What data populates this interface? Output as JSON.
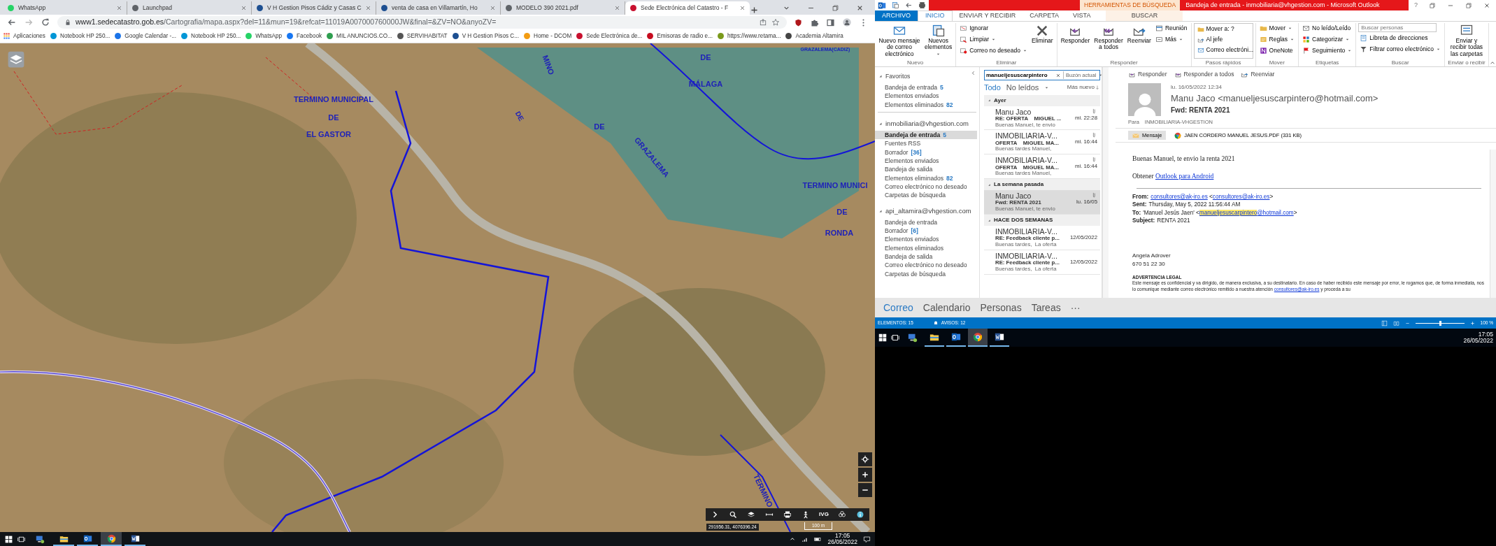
{
  "browser": {
    "tabs": [
      {
        "title": "WhatsApp",
        "selected": false,
        "color": "#25d366"
      },
      {
        "title": "Launchpad",
        "selected": false,
        "color": "#5f6368"
      },
      {
        "title": "V H Gestion Pisos Cádiz y Casas C",
        "selected": false,
        "color": "#1d4f91"
      },
      {
        "title": "venta de casa en Villamartín, Ho",
        "selected": false,
        "color": "#1d4f91"
      },
      {
        "title": "MODELO 390 2021.pdf",
        "selected": false,
        "color": "#5f6368"
      },
      {
        "title": "Sede Electrónica del Catastro - F",
        "selected": true,
        "color": "#c8102e"
      }
    ],
    "address": {
      "host": "www1.sedecatastro.gob.es",
      "path": "/Cartografia/mapa.aspx?del=11&mun=19&refcat=11019A007000760000JW&final=&ZV=NO&anyoZV="
    },
    "bookmarks": [
      {
        "label": "Aplicaciones",
        "kind": "apps"
      },
      {
        "label": "Notebook HP 250...",
        "kind": "site",
        "color": "#0096d6"
      },
      {
        "label": "Google Calendar -...",
        "kind": "site",
        "color": "#1a73e8"
      },
      {
        "label": "Notebook HP 250...",
        "kind": "site",
        "color": "#0096d6"
      },
      {
        "label": "WhatsApp",
        "kind": "site",
        "color": "#25d366"
      },
      {
        "label": "Facebook",
        "kind": "site",
        "color": "#1877f2"
      },
      {
        "label": "MIL ANUNCIOS.CO...",
        "kind": "site",
        "color": "#2e9e4f"
      },
      {
        "label": "SERVIHABITAT",
        "kind": "site",
        "color": "#555555"
      },
      {
        "label": "V H Gestion Pisos C...",
        "kind": "site",
        "color": "#1d4f91"
      },
      {
        "label": "Home - DCOM",
        "kind": "site",
        "color": "#f39c12"
      },
      {
        "label": "Sede Electrónica de...",
        "kind": "site",
        "color": "#c8102e"
      },
      {
        "label": "Emisoras de radio e...",
        "kind": "site",
        "color": "#c60b1e"
      },
      {
        "label": "https://www.retama...",
        "kind": "site",
        "color": "#7a9a1a"
      },
      {
        "label": "Academia Altamira",
        "kind": "site",
        "color": "#444444"
      }
    ]
  },
  "map": {
    "labels": [
      "GRAZALEMA(CADIZ)",
      "TERMINO MUNICIPAL",
      "DE",
      "EL GASTOR",
      "MINO",
      "DE",
      "MÁLAGA",
      "DE",
      "DE",
      "GRAZALEMA",
      "TERMINO MUNICI",
      "DE",
      "RONDA",
      "TERMINO"
    ],
    "tools": [
      {
        "kind": "expand"
      },
      {
        "kind": "search"
      },
      {
        "kind": "layers"
      },
      {
        "kind": "measure"
      },
      {
        "kind": "print"
      },
      {
        "kind": "person"
      },
      {
        "kind": "text",
        "label": "IVG"
      },
      {
        "kind": "globe"
      },
      {
        "kind": "info"
      }
    ],
    "side_controls": [
      {
        "kind": "locate"
      },
      {
        "kind": "zoom_in"
      },
      {
        "kind": "zoom_out"
      }
    ],
    "coordinates": "291956.31, 4076396.24",
    "scale": "100 m"
  },
  "taskbar_left": {
    "apps": [
      {
        "kind": "remote",
        "running": false,
        "active": false
      },
      {
        "kind": "explorer",
        "running": true,
        "active": false
      },
      {
        "kind": "outlook",
        "running": true,
        "active": false
      },
      {
        "kind": "chrome",
        "running": true,
        "active": true
      },
      {
        "kind": "word",
        "running": true,
        "active": false
      }
    ],
    "time": "17:05",
    "date": "26/05/2022"
  },
  "outlook": {
    "title_bar": {
      "context_tab": "HERRAMIENTAS DE BÚSQUEDA",
      "title": "Bandeja de entrada - inmobiliaria@vhgestion.com - Microsoft Outlook",
      "help": "?"
    },
    "ribbon_tabs": [
      {
        "label": "ARCHIVO",
        "kind": "file",
        "selected": false
      },
      {
        "label": "INICIO",
        "kind": "tab",
        "selected": true
      },
      {
        "label": "ENVIAR Y RECIBIR",
        "kind": "tab",
        "selected": false
      },
      {
        "label": "CARPETA",
        "kind": "tab",
        "selected": false
      },
      {
        "label": "VISTA",
        "kind": "tab",
        "selected": false
      },
      {
        "label": "BUSCAR",
        "kind": "context",
        "selected": false
      }
    ],
    "ribbon_groups": [
      {
        "label": "Nuevo",
        "items": [
          {
            "kind": "large",
            "label": "Nuevo mensaje de correo electrónico",
            "dropdown": false
          },
          {
            "kind": "large",
            "label": "Nuevos elementos",
            "dropdown": true
          }
        ]
      },
      {
        "label": "Eliminar",
        "items": [
          {
            "kind": "small",
            "label": "Ignorar",
            "dropdown": false
          },
          {
            "kind": "small",
            "label": "Limpiar",
            "dropdown": true
          },
          {
            "kind": "small",
            "label": "Correo no deseado",
            "dropdown": true
          },
          {
            "kind": "large",
            "label": "Eliminar",
            "dropdown": false
          }
        ]
      },
      {
        "label": "Responder",
        "items": [
          {
            "kind": "large",
            "label": "Responder",
            "dropdown": false
          },
          {
            "kind": "large",
            "label": "Responder a todos",
            "dropdown": false
          },
          {
            "kind": "large",
            "label": "Reenviar",
            "dropdown": false
          },
          {
            "kind": "small",
            "label": "Reunión",
            "dropdown": false
          },
          {
            "kind": "small",
            "label": "Más",
            "dropdown": true
          }
        ]
      },
      {
        "label": "Pasos rápidos",
        "items": [
          {
            "kind": "gallery",
            "label": "Mover a: ?"
          },
          {
            "kind": "gallery",
            "label": "Al jefe"
          },
          {
            "kind": "gallery",
            "label": "Correo electróni..."
          }
        ]
      },
      {
        "label": "Mover",
        "items": [
          {
            "kind": "small",
            "label": "Mover",
            "dropdown": true
          },
          {
            "kind": "small",
            "label": "Reglas",
            "dropdown": true
          },
          {
            "kind": "small",
            "label": "OneNote",
            "dropdown": false
          }
        ]
      },
      {
        "label": "Etiquetas",
        "items": [
          {
            "kind": "small",
            "label": "No leído/Leído",
            "dropdown": false
          },
          {
            "kind": "small",
            "label": "Categorizar",
            "dropdown": true
          },
          {
            "kind": "small",
            "label": "Seguimiento",
            "dropdown": true
          }
        ]
      },
      {
        "label": "Buscar",
        "items": [
          {
            "kind": "field",
            "placeholder": "Buscar personas"
          },
          {
            "kind": "small",
            "label": "Libreta de direcciones",
            "dropdown": false
          },
          {
            "kind": "small",
            "label": "Filtrar correo electrónico",
            "dropdown": true
          }
        ]
      },
      {
        "label": "Enviar o recibir",
        "items": [
          {
            "kind": "large",
            "label": "Enviar y recibir todas las carpetas",
            "dropdown": false
          }
        ]
      }
    ],
    "folder_sections": [
      {
        "title": "Favoritos",
        "expanded": true,
        "folders": [
          {
            "name": "Bandeja de entrada",
            "count": "5",
            "selected": false
          },
          {
            "name": "Elementos enviados",
            "selected": false
          },
          {
            "name": "Elementos eliminados",
            "count": "82",
            "selected": false
          }
        ]
      },
      {
        "title": "inmobiliaria@vhgestion.com",
        "expanded": true,
        "folders": [
          {
            "name": "Bandeja de entrada",
            "count": "5",
            "selected": true
          },
          {
            "name": "Fuentes RSS",
            "selected": false
          },
          {
            "name": "Borrador",
            "count": "[36]",
            "selected": false
          },
          {
            "name": "Elementos enviados",
            "selected": false
          },
          {
            "name": "Bandeja de salida",
            "selected": false
          },
          {
            "name": "Elementos eliminados",
            "count": "82",
            "selected": false
          },
          {
            "name": "Correo electrónico no deseado",
            "selected": false
          },
          {
            "name": "Carpetas de búsqueda",
            "selected": false
          }
        ]
      },
      {
        "title": "api_altamira@vhgestion.com",
        "expanded": true,
        "folders": [
          {
            "name": "Bandeja de entrada",
            "selected": false
          },
          {
            "name": "Borrador",
            "count": "[6]",
            "selected": false
          },
          {
            "name": "Elementos enviados",
            "selected": false
          },
          {
            "name": "Elementos eliminados",
            "selected": false
          },
          {
            "name": "Bandeja de salida",
            "selected": false
          },
          {
            "name": "Correo electrónico no deseado",
            "selected": false
          },
          {
            "name": "Carpetas de búsqueda",
            "selected": false
          }
        ]
      }
    ],
    "search": {
      "value": "manueljesuscarpintero",
      "scope": "Buzón actual"
    },
    "filters": [
      {
        "label": "Todo",
        "selected": true
      },
      {
        "label": "No leídos",
        "selected": false
      }
    ],
    "sort": "Más nuevo",
    "message_groups": [
      {
        "header": "Ayer",
        "expanded": true,
        "messages": [
          {
            "sender": "Manu Jaco",
            "subject": "RE: OFERTA    MIGUEL ...",
            "preview": "Buenas Manuel, te envio",
            "date": "mi. 22:28",
            "attachment": true,
            "selected": false
          },
          {
            "sender": "INMOBILIARIA-V...",
            "subject": "OFERTA    MIGUEL MA...",
            "preview": "Buenas tardes Manuel,",
            "date": "mi. 16:44",
            "attachment": true,
            "selected": false
          },
          {
            "sender": "INMOBILIARIA-V...",
            "subject": "OFERTA    MIGUEL MA...",
            "preview": "Buenas tardes Manuel,",
            "date": "mi. 16:44",
            "attachment": true,
            "selected": false
          }
        ]
      },
      {
        "header": "La semana pasada",
        "expanded": true,
        "messages": [
          {
            "sender": "Manu Jaco",
            "subject": "Fwd: RENTA 2021",
            "preview": "Buenas Manuel, te envio",
            "date": "lu. 16/05",
            "attachment": true,
            "selected": true
          }
        ]
      },
      {
        "header": "HACE DOS SEMANAS",
        "expanded": true,
        "messages": [
          {
            "sender": "INMOBILIARIA-V...",
            "subject": "RE: Feedback cliente p...",
            "preview": "Buenas tardes,  La oferta",
            "date": "12/05/2022",
            "attachment": false,
            "selected": false
          },
          {
            "sender": "INMOBILIARIA-V...",
            "subject": "RE: Feedback cliente p...",
            "preview": "Buenas tardes,  La oferta",
            "date": "12/05/2022",
            "attachment": false,
            "selected": false
          }
        ]
      }
    ],
    "reading": {
      "actions": [
        {
          "label": "Responder"
        },
        {
          "label": "Responder a todos"
        },
        {
          "label": "Reenviar"
        }
      ],
      "date": "lu. 16/05/2022 12:34",
      "from": "Manu Jaco <manueljesuscarpintero@hotmail.com>",
      "subject": "Fwd: RENTA 2021",
      "to_label": "Para",
      "to": "INMOBILIARIA-VHGESTION",
      "attachments": [
        {
          "label": "Mensaje",
          "kind": "message",
          "selected": true
        },
        {
          "label": "JAEN CORDERO MANUEL JESUS.PDF (331 KB)",
          "kind": "pdf",
          "selected": false
        }
      ],
      "body": [
        {
          "kind": "serif",
          "segments": [
            {
              "text": "Buenas Manuel, te envio la renta 2021"
            }
          ]
        },
        {
          "kind": "serif",
          "segments": [
            {
              "text": "Obtener "
            },
            {
              "text": "Outlook para Android",
              "link": true
            }
          ]
        },
        {
          "kind": "rule"
        },
        {
          "kind": "header",
          "label": "From:",
          "segments": [
            {
              "text": "consultores@ak-iro.es",
              "link": true
            },
            {
              "text": " <"
            },
            {
              "text": "consultores@ak-iro.es",
              "link": true
            },
            {
              "text": ">"
            }
          ]
        },
        {
          "kind": "header",
          "label": "Sent:",
          "segments": [
            {
              "text": "Thursday, May 5, 2022 11:56:44 AM"
            }
          ]
        },
        {
          "kind": "header",
          "label": "To:",
          "segments": [
            {
              "text": "'Manuel Jesús Jaen' <"
            },
            {
              "text": "manueljesuscarpintero",
              "link": true,
              "highlight": true
            },
            {
              "text": "@hotmail.com",
              "link": true
            },
            {
              "text": ">"
            }
          ]
        },
        {
          "kind": "header",
          "label": "Subject:",
          "segments": [
            {
              "text": "RENTA 2021"
            }
          ]
        },
        {
          "kind": "signature",
          "segments": [
            {
              "text": "Angela Adrover"
            }
          ]
        },
        {
          "kind": "plain",
          "segments": [
            {
              "text": "670 51 22 30"
            }
          ]
        },
        {
          "kind": "legal_title",
          "segments": [
            {
              "text": "ADVERTENCIA LEGAL"
            }
          ]
        },
        {
          "kind": "small",
          "segments": [
            {
              "text": "Este mensaje es confidencial y va dirigido, de manera exclusiva, a su destinatario. En caso de haber recibido este mensaje por error, le rogamos que, de forma inmediata, nos lo comunique mediante correo electrónico remitido a nuestra atención "
            },
            {
              "text": "consultores@ak-iro.es",
              "link": true
            },
            {
              "text": " y proceda a su"
            }
          ]
        }
      ]
    },
    "nav": [
      {
        "label": "Correo",
        "selected": true
      },
      {
        "label": "Calendario",
        "selected": false
      },
      {
        "label": "Personas",
        "selected": false
      },
      {
        "label": "Tareas",
        "selected": false
      },
      {
        "label": "···",
        "selected": false
      }
    ],
    "status": {
      "items": "ELEMENTOS: 15",
      "alerts": "AVISOS: 12",
      "zoom": "100 %",
      "level": 0.5
    },
    "taskbar": {
      "apps": [
        {
          "kind": "remote",
          "running": false,
          "active": false
        },
        {
          "kind": "explorer",
          "running": true,
          "active": false
        },
        {
          "kind": "outlook",
          "running": true,
          "active": false
        },
        {
          "kind": "chrome",
          "running": true,
          "active": true
        },
        {
          "kind": "word",
          "running": true,
          "active": false
        }
      ],
      "time": "17:05",
      "date": "26/05/2022"
    }
  }
}
